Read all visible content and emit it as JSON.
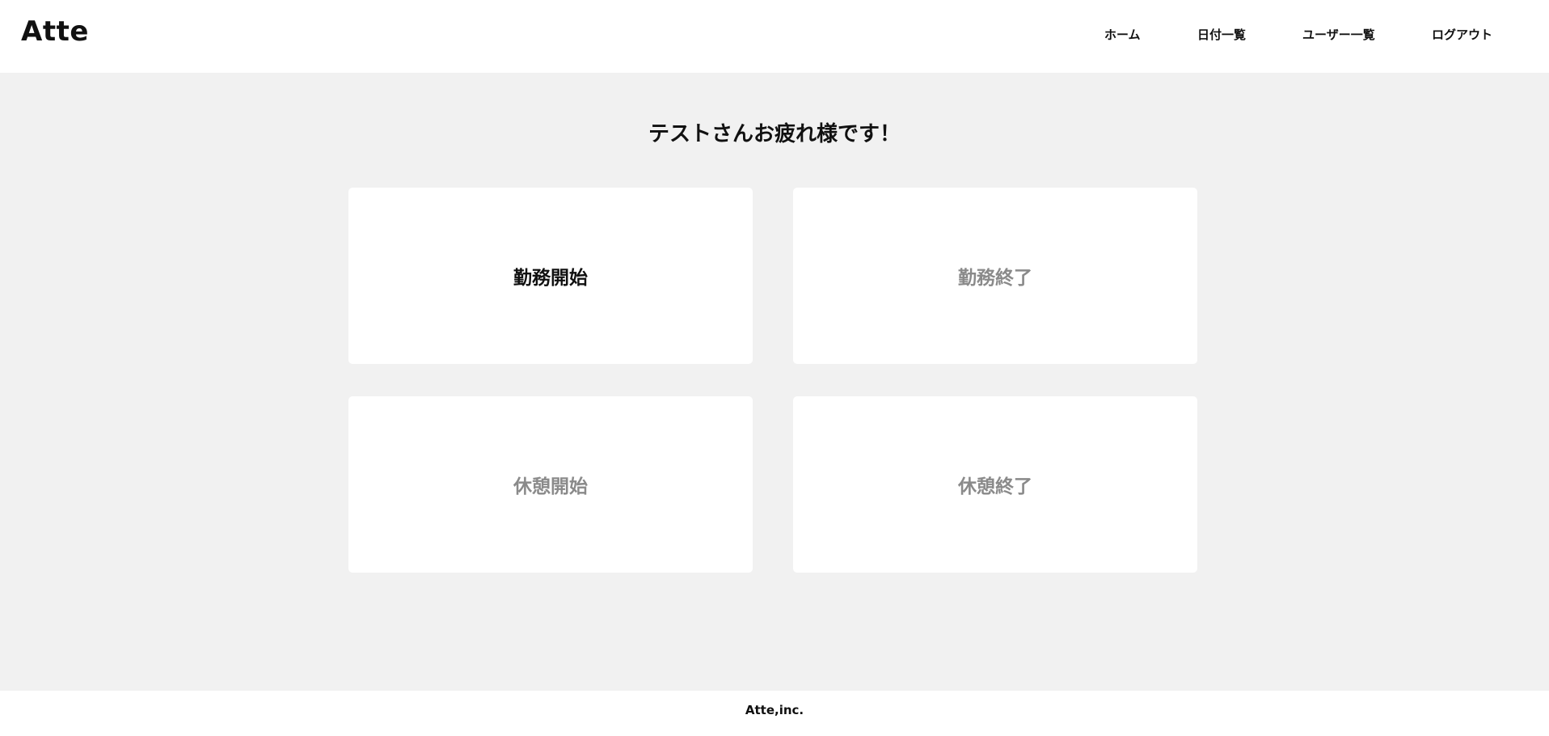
{
  "header": {
    "logo": "Atte",
    "nav": [
      {
        "label": "ホーム"
      },
      {
        "label": "日付一覧"
      },
      {
        "label": "ユーザー一覧"
      },
      {
        "label": "ログアウト"
      }
    ]
  },
  "main": {
    "greeting": "テストさんお疲れ様です！",
    "buttons": {
      "work_start": {
        "label": "勤務開始",
        "enabled": true
      },
      "work_end": {
        "label": "勤務終了",
        "enabled": false
      },
      "break_start": {
        "label": "休憩開始",
        "enabled": false
      },
      "break_end": {
        "label": "休憩終了",
        "enabled": false
      }
    }
  },
  "footer": {
    "text": "Atte,inc."
  },
  "colors": {
    "page_background": "#f1f1f1",
    "surface": "#ffffff",
    "text": "#111111",
    "disabled_text": "#8a8a8a"
  }
}
